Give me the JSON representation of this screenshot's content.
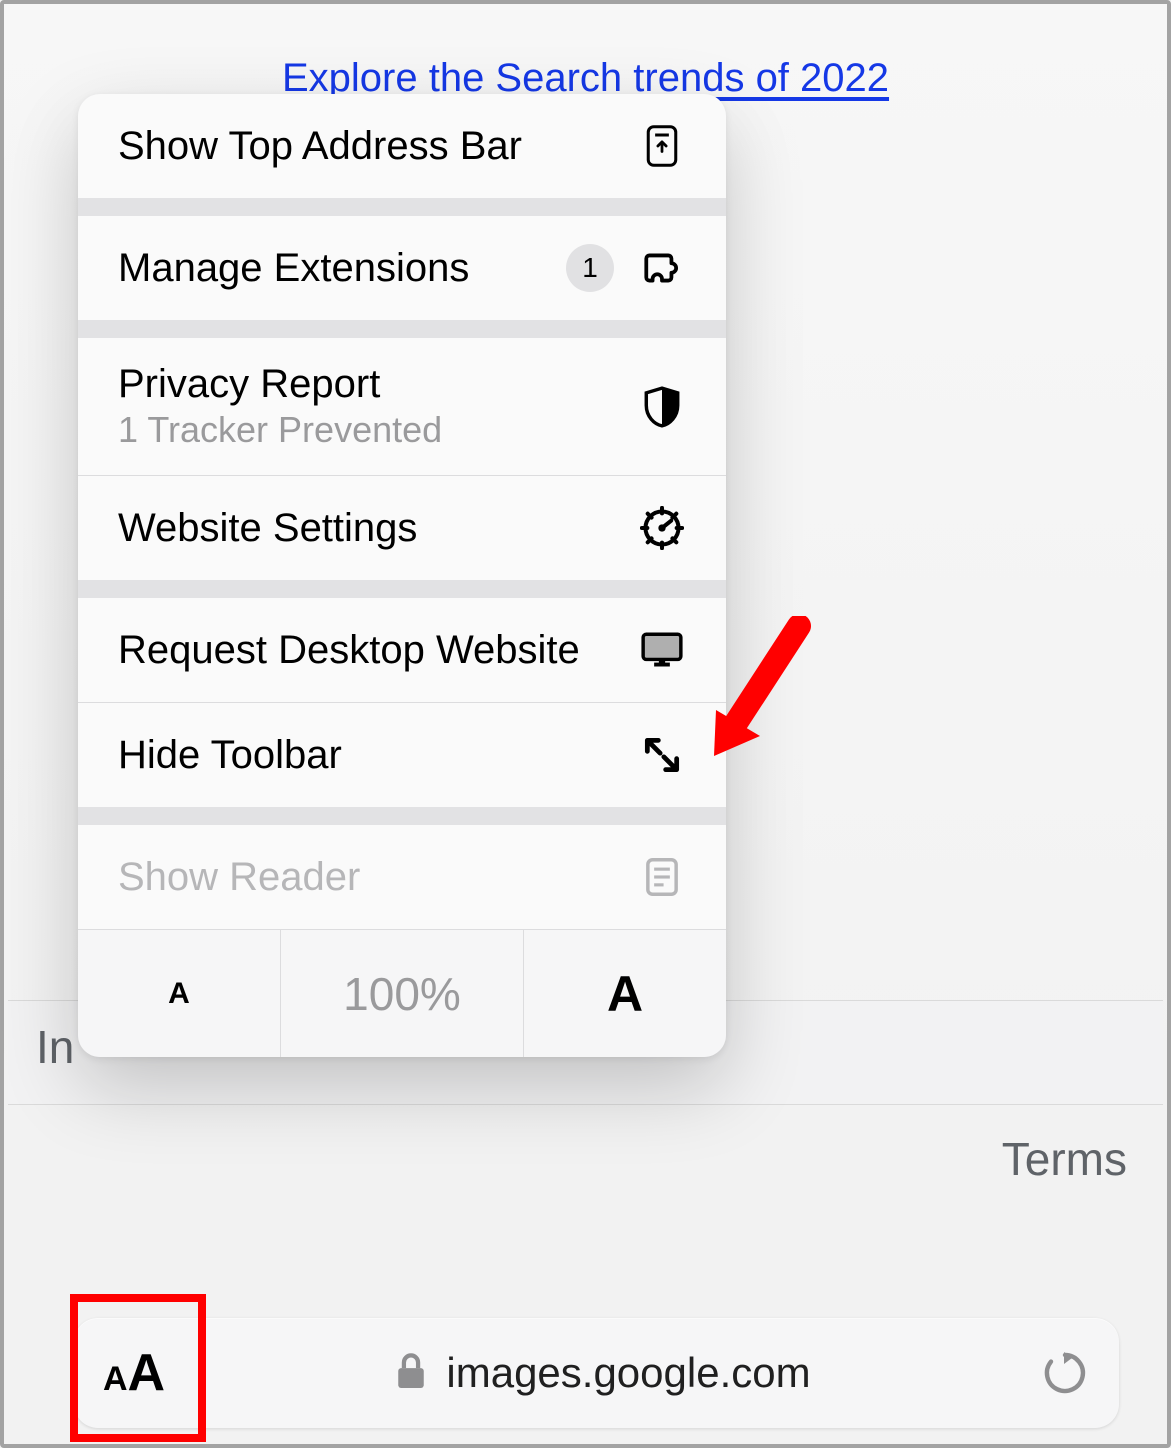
{
  "page": {
    "top_link_text": "Explore the Search trends of 2022",
    "footer_left_partial": "In",
    "footer_terms": "Terms"
  },
  "address_bar": {
    "aa_small": "A",
    "aa_large": "A",
    "domain": "images.google.com"
  },
  "menu": {
    "show_top_addr": "Show Top Address Bar",
    "manage_ext": "Manage Extensions",
    "manage_ext_count": "1",
    "privacy_report": "Privacy Report",
    "privacy_sub": "1 Tracker Prevented",
    "website_settings": "Website Settings",
    "req_desktop": "Request Desktop Website",
    "hide_toolbar": "Hide Toolbar",
    "show_reader": "Show Reader",
    "text_size": {
      "smaller": "A",
      "percent": "100%",
      "larger": "A"
    }
  }
}
